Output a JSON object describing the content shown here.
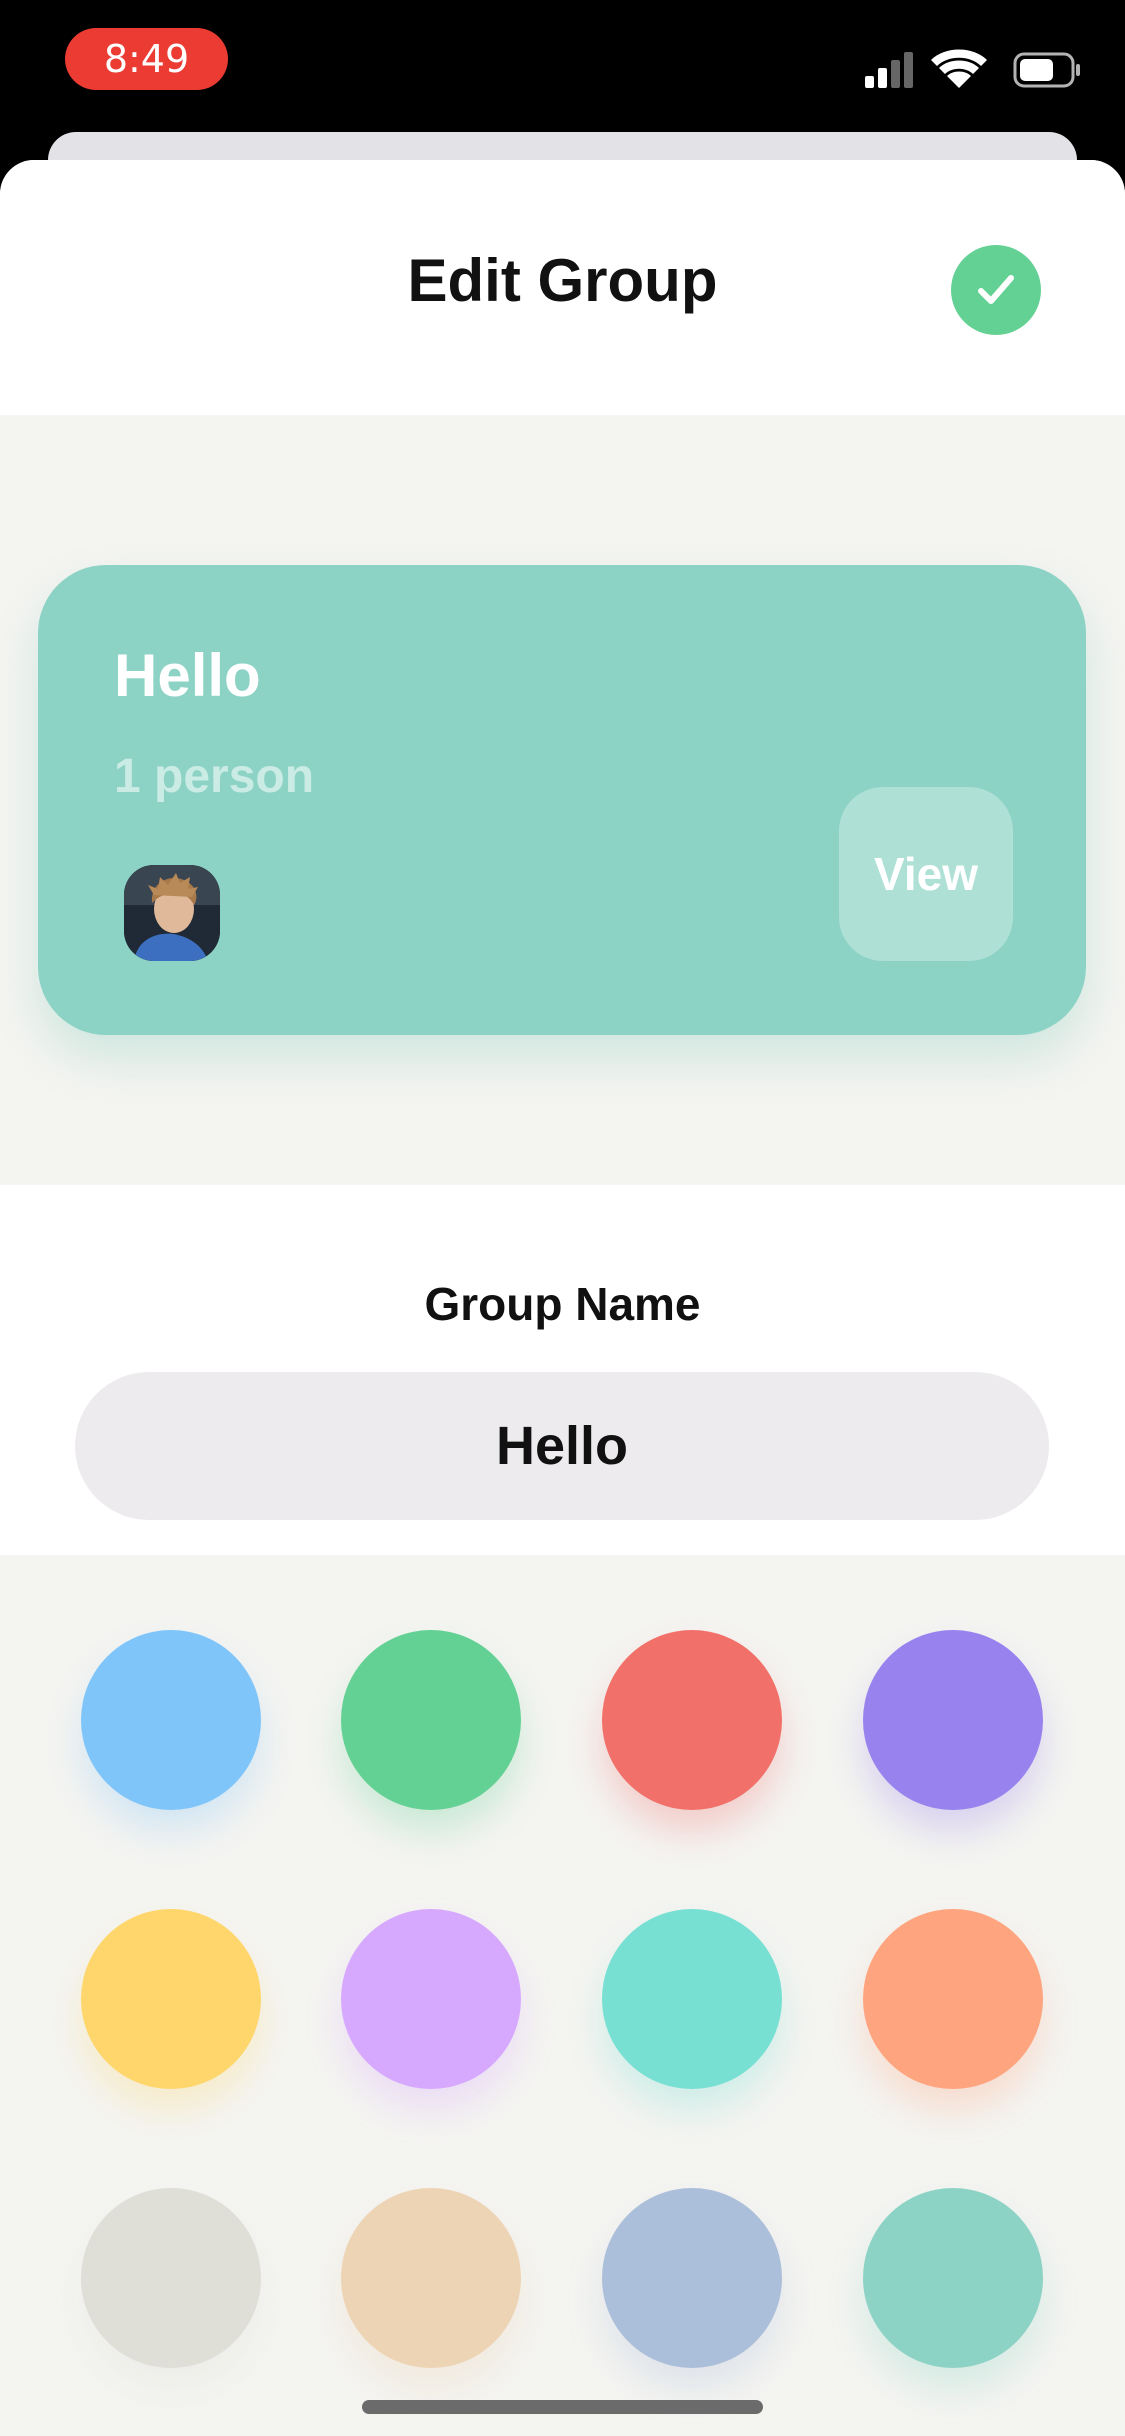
{
  "status_bar": {
    "time": "8:49",
    "icons": [
      "cellular-signal-icon",
      "wifi-icon",
      "battery-icon"
    ]
  },
  "header": {
    "title": "Edit Group",
    "done_icon": "checkmark-icon",
    "accent": "#63d193"
  },
  "group_card": {
    "title": "Hello",
    "member_count": "1 person",
    "view_label": "View",
    "color": "#8dd3c5"
  },
  "group_name": {
    "label": "Group Name",
    "value": "Hello"
  },
  "colors": [
    "#80c5fa",
    "#63d193",
    "#f2706a",
    "#9782ee",
    "#fed66c",
    "#d7a9fe",
    "#77e0d3",
    "#fea47e",
    "#dfdfd8",
    "#edd4b5",
    "#acbfda",
    "#8dd3c5"
  ]
}
